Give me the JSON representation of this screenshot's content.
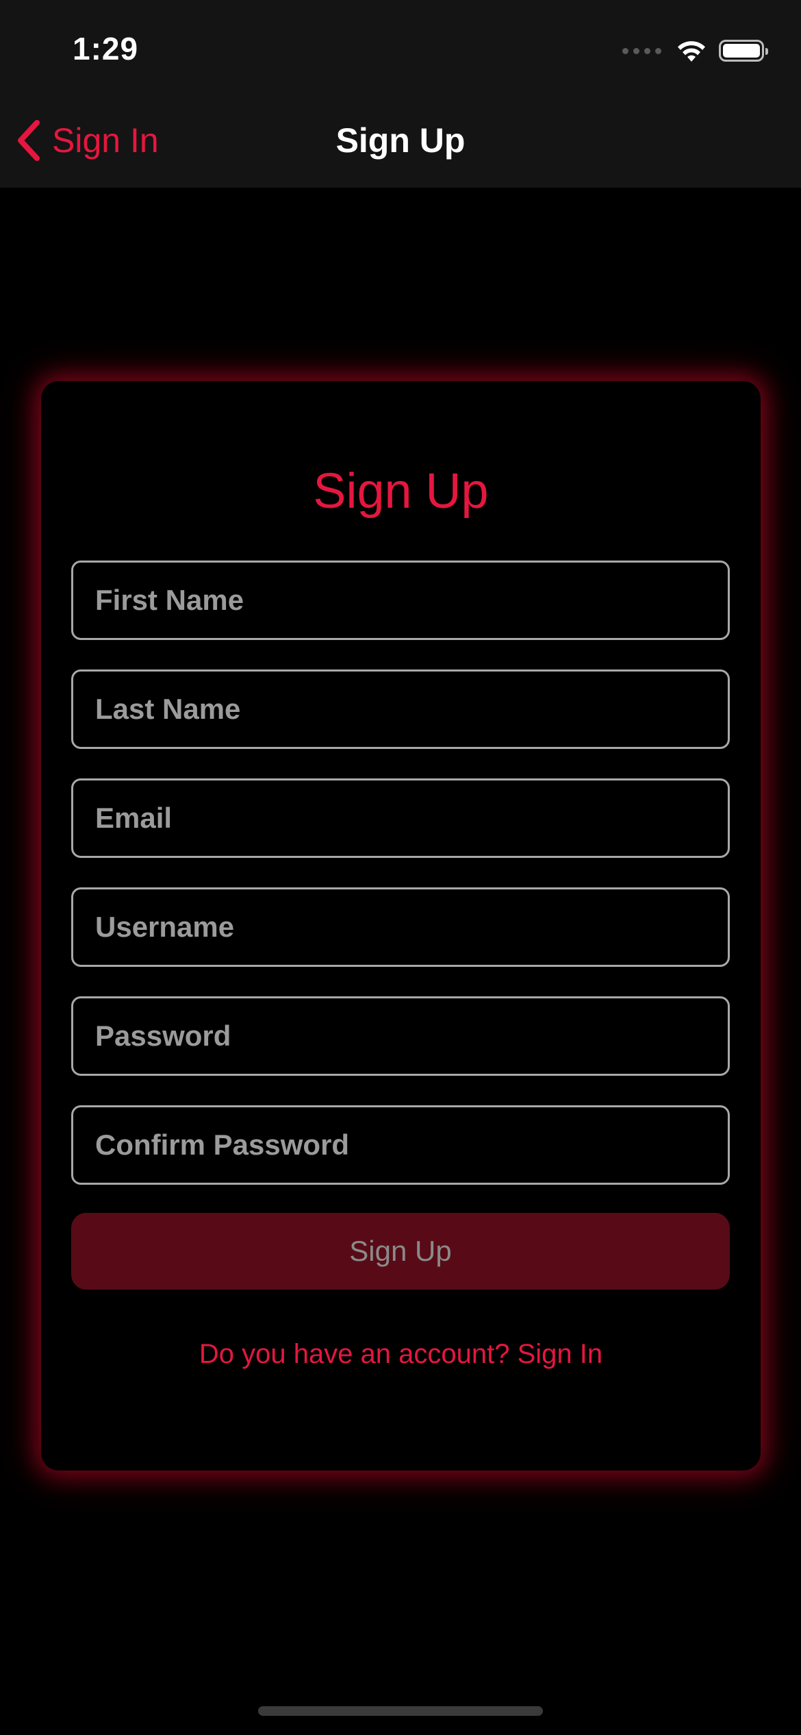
{
  "status_bar": {
    "time": "1:29",
    "icons": [
      "cellular-signal-icon",
      "wifi-icon",
      "battery-icon"
    ]
  },
  "nav": {
    "back_label": "Sign In",
    "title": "Sign Up"
  },
  "form": {
    "title": "Sign Up",
    "fields": {
      "first_name": {
        "placeholder": "First Name",
        "value": ""
      },
      "last_name": {
        "placeholder": "Last Name",
        "value": ""
      },
      "email": {
        "placeholder": "Email",
        "value": ""
      },
      "username": {
        "placeholder": "Username",
        "value": ""
      },
      "password": {
        "placeholder": "Password",
        "value": ""
      },
      "confirm_password": {
        "placeholder": "Confirm Password",
        "value": ""
      }
    },
    "submit_label": "Sign Up",
    "submit_enabled": false,
    "signin_prompt": "Do you have an account? Sign In"
  },
  "colors": {
    "accent": "#e5173f",
    "button_disabled_bg": "#580b17",
    "background": "#000000",
    "bar_background": "#141414"
  }
}
